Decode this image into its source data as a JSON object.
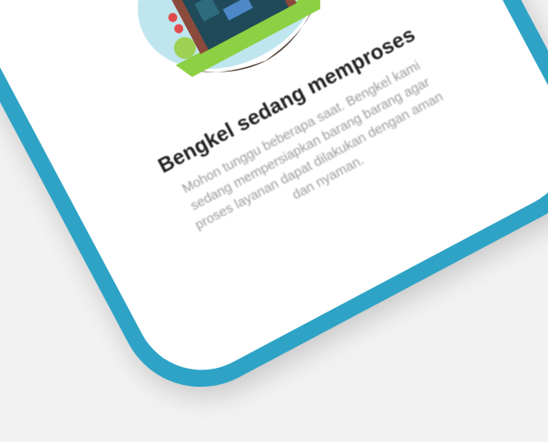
{
  "status": {
    "title": "Bengkel sedang memproses",
    "description": "Mohon tunggu beberapa saat. Bengkel kami sedang mempersiapkan barang barang agar proses layanan dapat dilakukan dengan aman dan nyaman."
  },
  "illustration": {
    "icon": "workshop-illustration-icon",
    "colors": {
      "sky": "#bfe6ee",
      "building": "#8b4a3b",
      "awning": "#e8eef0",
      "interior": "#1f4a5a",
      "sign": "#e24b4b",
      "grass": "#8cd043",
      "soil": "#5a4a3e"
    }
  },
  "frame": {
    "accent": "#2ea3c6",
    "screen": "#ffffff",
    "background": "#f2f2f2"
  }
}
